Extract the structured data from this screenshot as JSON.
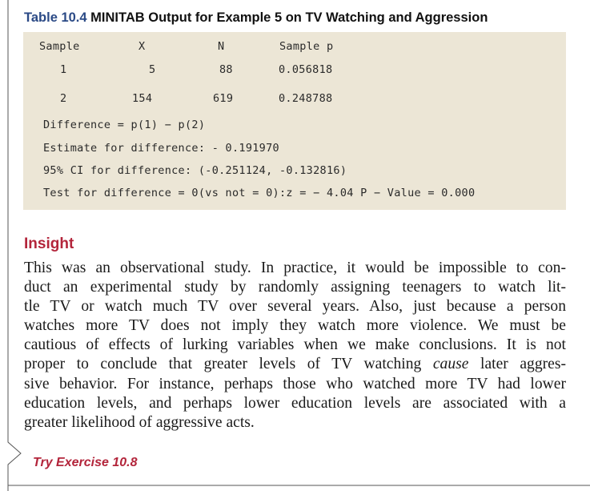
{
  "table": {
    "number": "Table 10.4",
    "title": "MINITAB Output for Example 5 on TV Watching and Aggression",
    "headers": [
      "Sample",
      "X",
      "N",
      "Sample p"
    ],
    "rows": [
      [
        "1",
        "5",
        "88",
        "0.056818"
      ],
      [
        "2",
        "154",
        "619",
        "0.248788"
      ]
    ],
    "summary": [
      "Difference = p(1) − p(2)",
      "Estimate for difference: - 0.191970",
      "95% CI for difference: (-0.251124, -0.132816)",
      "Test for difference = 0(vs not = 0):z = − 4.04 P − Value = 0.000"
    ]
  },
  "insight": {
    "heading": "Insight",
    "lines": [
      "This was an observational study. In practice, it would be impossible to con-",
      "duct an experimental study by randomly assigning teenagers to watch lit-",
      "tle TV or watch much TV over several years. Also, just because a person",
      "watches more TV does not imply they watch more violence. We must be",
      "cautious of effects of lurking variables when we make conclusions. It is not"
    ],
    "line6_before": "proper to conclude that greater levels of TV watching ",
    "line6_emph": "cause",
    "line6_after": " later aggres-",
    "lines_end": [
      "sive behavior. For instance, perhaps those who watched more TV had lower",
      "education levels, and perhaps lower education levels are associated with a",
      "greater likelihood of aggressive acts."
    ]
  },
  "try_exercise": "Try Exercise 10.8",
  "colors": {
    "output_background": "#ece6d6",
    "accent_red": "#b3253b",
    "table_number_blue": "#2b4a86"
  }
}
